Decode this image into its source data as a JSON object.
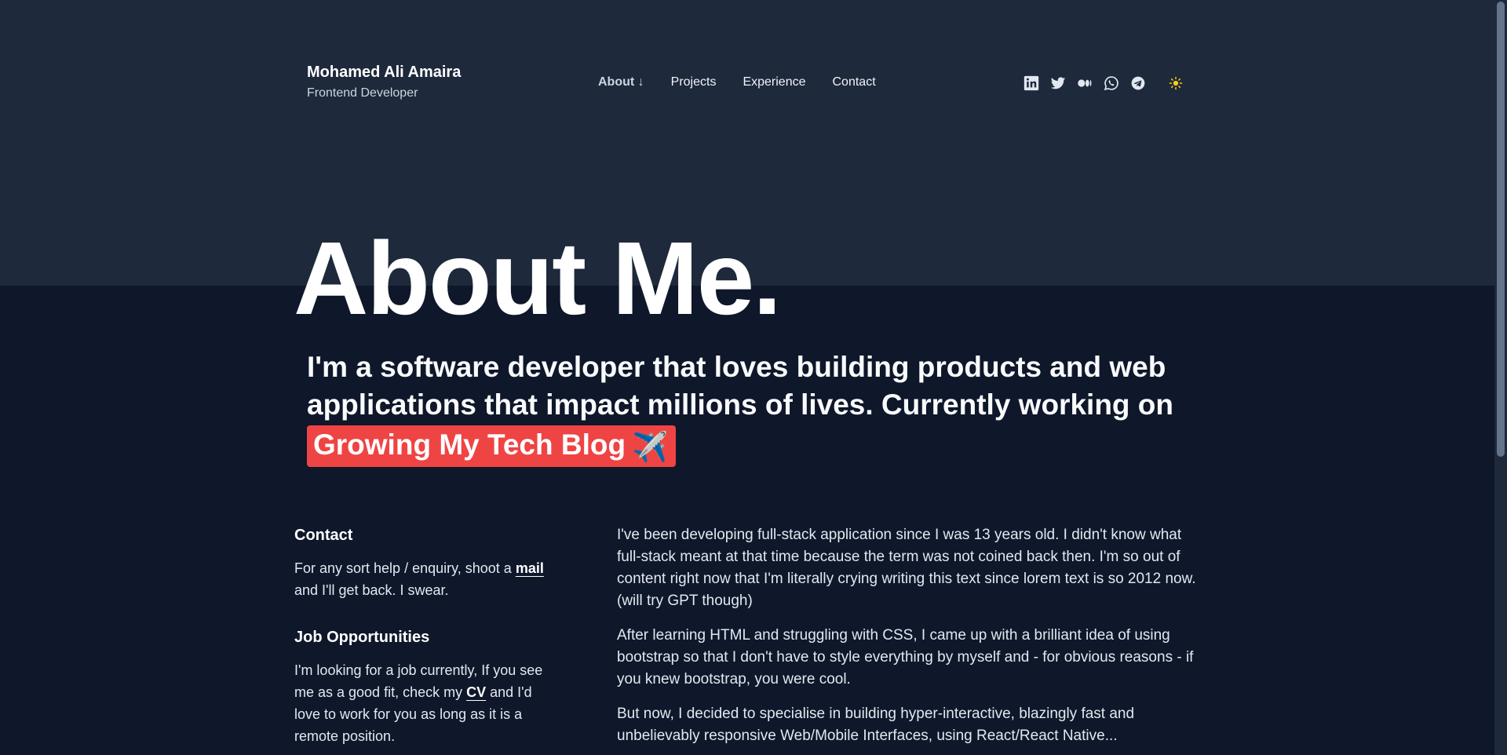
{
  "header": {
    "name": "Mohamed Ali Amaira",
    "role": "Frontend Developer"
  },
  "nav": {
    "items": [
      {
        "label": "About ↓",
        "active": true
      },
      {
        "label": "Projects",
        "active": false
      },
      {
        "label": "Experience",
        "active": false
      },
      {
        "label": "Contact",
        "active": false
      }
    ]
  },
  "socials": [
    "linkedin-icon",
    "twitter-icon",
    "medium-icon",
    "whatsapp-icon",
    "telegram-icon"
  ],
  "theme_toggle": {
    "icon": "sun-icon",
    "glyph": "☀"
  },
  "hero": {
    "title": "About Me.",
    "tagline": "I'm a software developer that loves building products and web applications that impact millions of lives. Currently working on",
    "highlight": "Growing My Tech Blog",
    "highlight_emoji": "✈️"
  },
  "contact": {
    "heading": "Contact",
    "text_before": "For any sort help / enquiry, shoot a",
    "link": "mail",
    "text_after": "and I'll get back. I swear."
  },
  "jobs": {
    "heading": "Job Opportunities",
    "text_before": "I'm looking for a job currently, If you see me as a good fit, check my",
    "link": "CV",
    "text_after": "and I'd love to work for you as long as it is a remote position."
  },
  "about": {
    "paragraphs": [
      "I've been developing full-stack application since I was 13 years old. I didn't know what full-stack meant at that time because the term was not coined back then. I'm so out of content right now that I'm literally crying writing this text since lorem text is so 2012 now. (will try GPT though)",
      "After learning HTML and struggling with CSS, I came up with a brilliant idea of using bootstrap so that I don't have to style everything by myself and - for obvious reasons - if you knew bootstrap, you were cool.",
      "But now, I decided to specialise in building hyper-interactive, blazingly fast and unbelievably responsive Web/Mobile Interfaces, using React/React Native..."
    ]
  },
  "colors": {
    "background": "#0f172a",
    "band": "#1e293b",
    "highlight": "#ef4444",
    "sun": "#facc15"
  }
}
